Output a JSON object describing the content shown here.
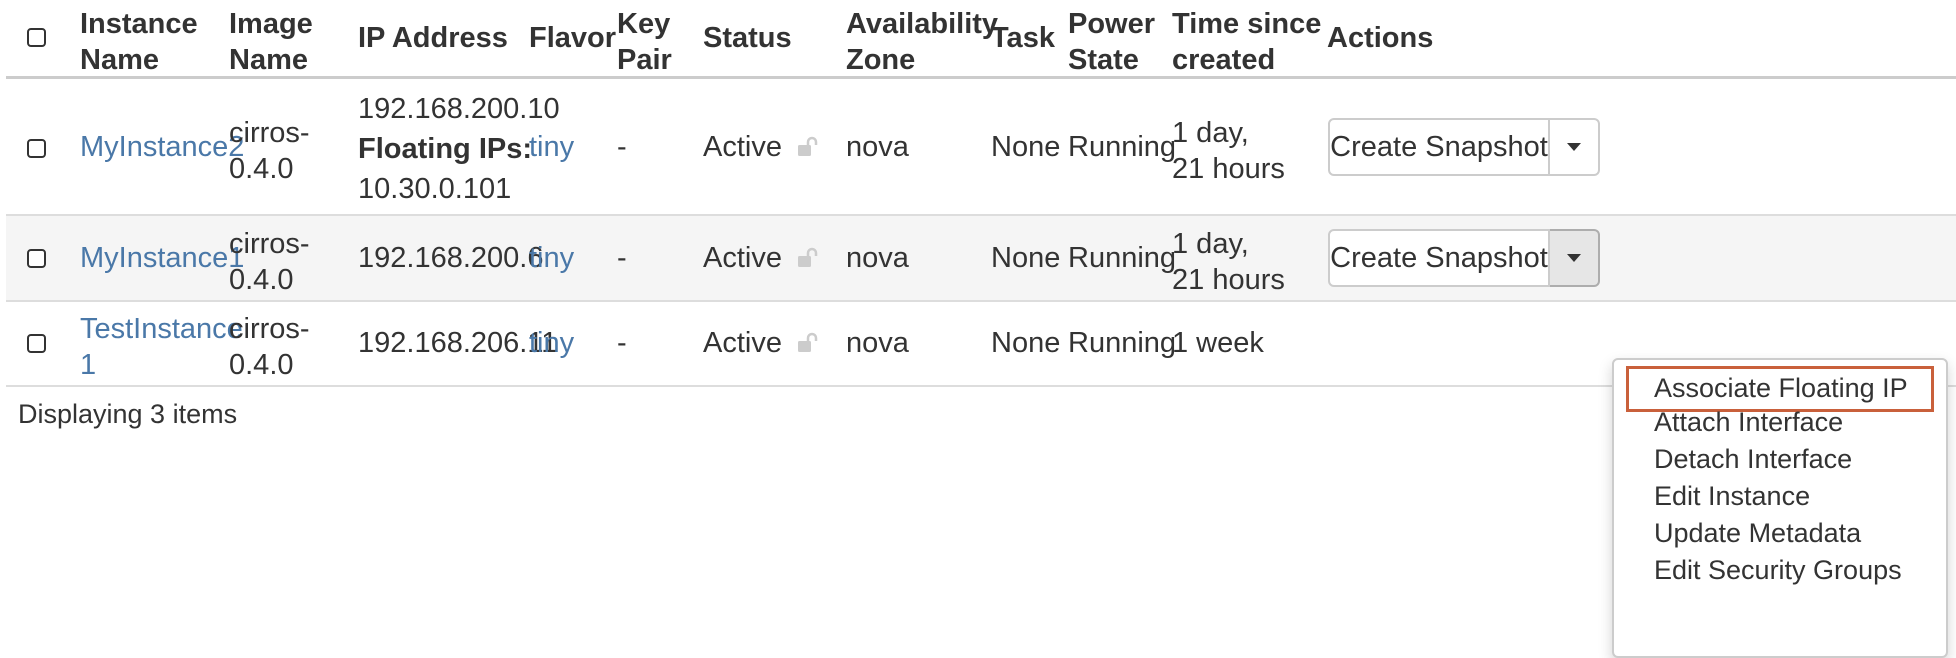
{
  "table": {
    "columns": {
      "instance_name": [
        "Instance",
        "Name"
      ],
      "image_name": [
        "Image",
        "Name"
      ],
      "ip_address": "IP Address",
      "flavor": "Flavor",
      "key_pair": [
        "Key",
        "Pair"
      ],
      "status": "Status",
      "availability_zone": [
        "Availability",
        "Zone"
      ],
      "task": "Task",
      "power_state": [
        "Power",
        "State"
      ],
      "time_since_created": [
        "Time since",
        "created"
      ],
      "actions": "Actions"
    },
    "rows": [
      {
        "instance_name": [
          "MyInstance2"
        ],
        "image_name": [
          "cirros-",
          "0.4.0"
        ],
        "ip": "192.168.200.10",
        "floating_label": "Floating IPs:",
        "floating_ip": "10.30.0.101",
        "flavor": "tiny",
        "key_pair": "-",
        "status": "Active",
        "availability_zone": "nova",
        "task": "None",
        "power_state": "Running",
        "time_since_created": [
          "1 day,",
          "21 hours"
        ],
        "action_label": "Create Snapshot"
      },
      {
        "instance_name": [
          "MyInstance1"
        ],
        "image_name": [
          "cirros-",
          "0.4.0"
        ],
        "ip": "192.168.200.6",
        "flavor": "tiny",
        "key_pair": "-",
        "status": "Active",
        "availability_zone": "nova",
        "task": "None",
        "power_state": "Running",
        "time_since_created": [
          "1 day,",
          "21 hours"
        ],
        "action_label": "Create Snapshot"
      },
      {
        "instance_name": [
          "TestInstance",
          "1"
        ],
        "image_name": [
          "cirros-",
          "0.4.0"
        ],
        "ip": "192.168.206.11",
        "flavor": "tiny",
        "key_pair": "-",
        "status": "Active",
        "availability_zone": "nova",
        "task": "None",
        "power_state": "Running",
        "time_since_created": [
          "1 week"
        ]
      }
    ],
    "footer": "Displaying 3 items"
  },
  "dropdown_menu": {
    "items": [
      "Associate Floating IP",
      "Attach Interface",
      "Detach Interface",
      "Edit Instance",
      "Update Metadata",
      "Edit Security Groups"
    ],
    "highlight_color": "#c9603b"
  },
  "colors": {
    "link": "#4a78a8",
    "text": "#333333",
    "row_hover": "#f5f5f5",
    "border": "#dddddd"
  },
  "icons": {
    "lock": "unlocked-padlock-icon",
    "caret": "chevron-down-icon"
  }
}
